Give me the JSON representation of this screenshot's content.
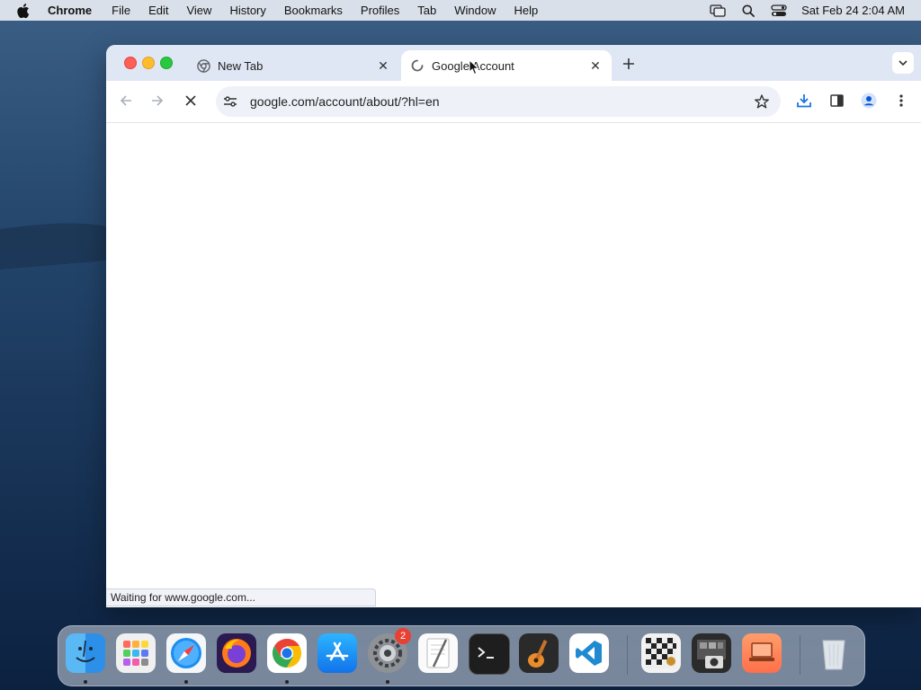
{
  "menubar": {
    "app_name": "Chrome",
    "items": [
      "File",
      "Edit",
      "View",
      "History",
      "Bookmarks",
      "Profiles",
      "Tab",
      "Window",
      "Help"
    ],
    "clock": "Sat Feb 24  2:04 AM"
  },
  "browser": {
    "tabs": [
      {
        "title": "New Tab",
        "active": false
      },
      {
        "title": "Google Account",
        "active": true
      }
    ],
    "url": "google.com/account/about/?hl=en",
    "status": "Waiting for www.google.com..."
  },
  "dock": {
    "apps": [
      "finder-icon",
      "launchpad-icon",
      "safari-icon",
      "firefox-icon",
      "chrome-icon",
      "app-store-icon",
      "system-settings-icon",
      "textedit-icon",
      "terminal-icon",
      "garageband-icon",
      "vscode-icon",
      "chess-icon",
      "photo-booth-icon",
      "remote-desktop-icon",
      "trash-icon"
    ],
    "settings_badge": "2"
  },
  "colors": {
    "tabstrip": "#dfe6f4",
    "omnibox": "#eef1f8",
    "accent": "#1a73e8"
  }
}
